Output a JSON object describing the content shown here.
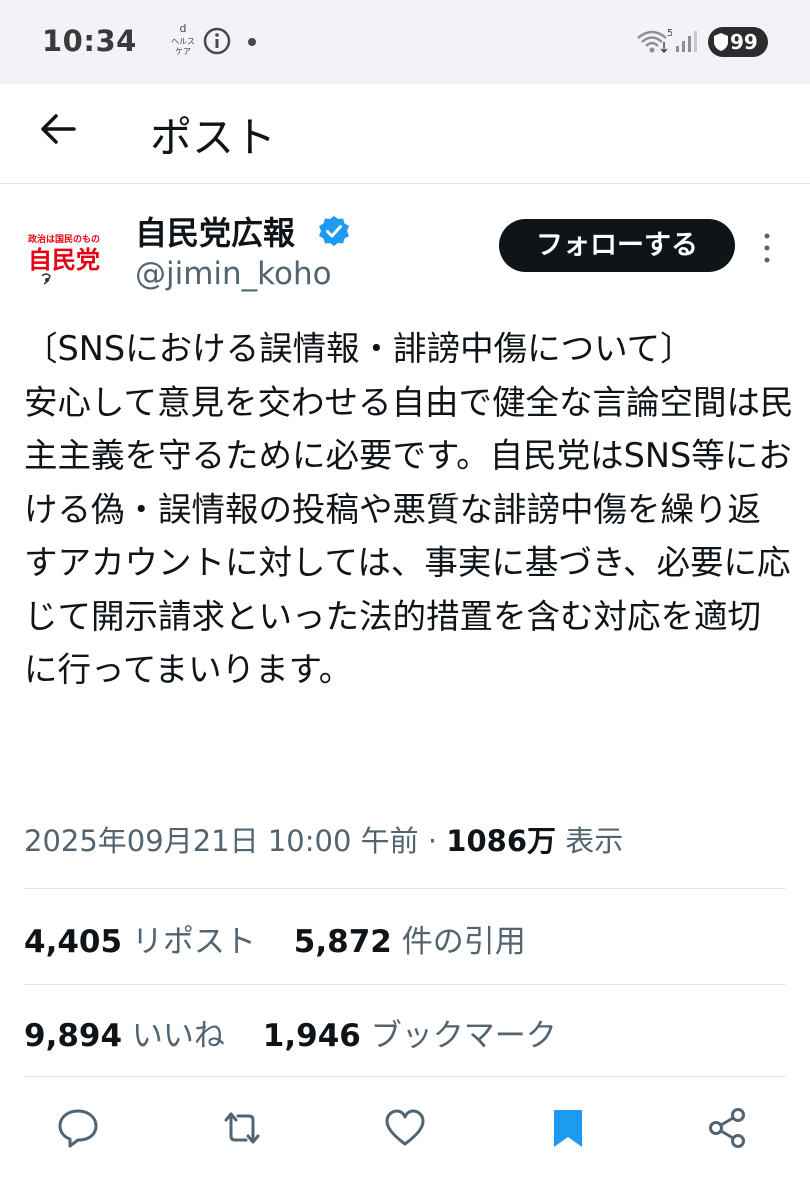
{
  "status_bar": {
    "time": "10:34",
    "health_app_glyph": "d\nヘルス\nケア",
    "icons": [
      "health-care-icon",
      "info-icon",
      "dot-icon",
      "wifi-icon",
      "signal-icon",
      "battery-icon"
    ],
    "battery": "99",
    "wifi_label": "5"
  },
  "header": {
    "title": "ポスト",
    "back_icon": "arrow-left-icon"
  },
  "author": {
    "name": "自民党広報",
    "handle": "@jimin_koho",
    "verified_icon": "verified-badge-icon",
    "avatar_small_text": "政治は国民のもの",
    "avatar_big_text": "自民党",
    "follow_label": "フォローする",
    "more_icon": "more-vertical-icon"
  },
  "post": {
    "text": "〔SNSにおける誤情報・誹謗中傷について〕\n安心して意見を交わせる自由で健全な言論空間は民主主義を守るために必要です。自民党はSNS等における偽・誤情報の投稿や悪質な誹謗中傷を繰り返すアカウントに対しては、事実に基づき、必要に応じて開示請求といった法的措置を含む対応を適切に行ってまいります。",
    "datetime": "2025年09月21日 10:00 午前",
    "separator": " · ",
    "views_count": "1086万",
    "views_label": " 表示"
  },
  "stats": {
    "reposts_count": "4,405",
    "reposts_label": " リポスト",
    "quotes_count": "5,872",
    "quotes_label": " 件の引用",
    "likes_count": "9,894",
    "likes_label": " いいね",
    "bookmarks_count": "1,946",
    "bookmarks_label": " ブックマーク"
  },
  "actions": [
    "reply-icon",
    "repost-icon",
    "like-icon",
    "bookmark-icon",
    "share-icon"
  ],
  "colors": {
    "text_primary": "#0f1419",
    "text_secondary": "#536471",
    "accent": "#1d9bf0",
    "divider": "#e3e7ea",
    "avatar_red": "#e60012"
  }
}
